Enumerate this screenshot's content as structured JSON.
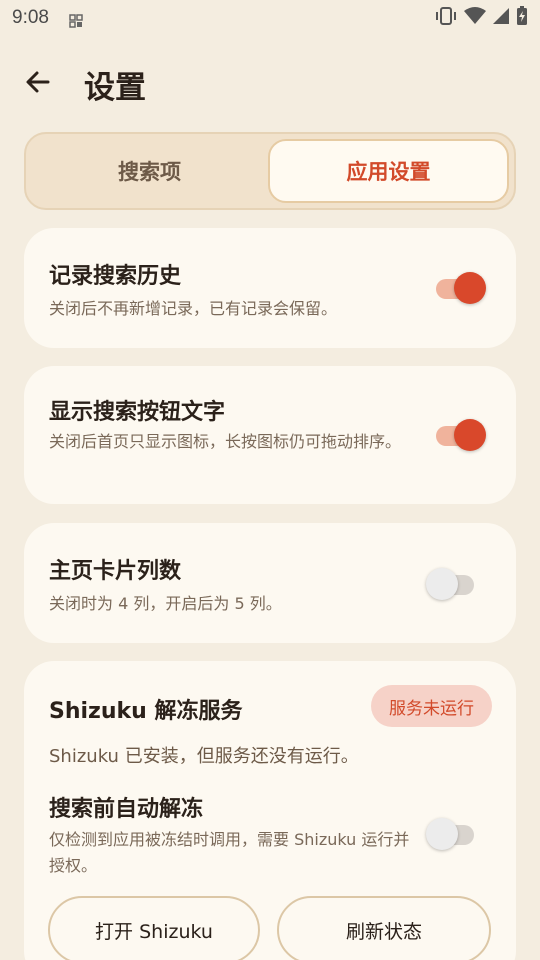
{
  "status_bar": {
    "time": "9:08",
    "icons": [
      "notification-icon",
      "vibrate-icon",
      "wifi-icon",
      "signal-icon",
      "battery-charging-icon"
    ]
  },
  "header": {
    "title": "设置",
    "back_icon": "arrow-left-icon"
  },
  "tabs": [
    {
      "label": "搜索项",
      "active": false
    },
    {
      "label": "应用设置",
      "active": true
    }
  ],
  "settings": [
    {
      "title": "记录搜索历史",
      "desc": "关闭后不再新增记录，已有记录会保留。",
      "enabled": true
    },
    {
      "title": "显示搜索按钮文字",
      "desc": "关闭后首页只显示图标，长按图标仍可拖动排序。",
      "enabled": true
    },
    {
      "title": "主页卡片列数",
      "desc": "关闭时为 4 列，开启后为 5 列。",
      "enabled": false
    }
  ],
  "shizuku": {
    "title": "Shizuku 解冻服务",
    "status_badge": "服务未运行",
    "status_text": "Shizuku 已安装，但服务还没有运行。",
    "auto_unfreeze_title": "搜索前自动解冻",
    "auto_unfreeze_desc": "仅检测到应用被冻结时调用，需要 Shizuku 运行并授权。",
    "auto_unfreeze_enabled": false,
    "open_button": "打开 Shizuku",
    "refresh_button": "刷新状态"
  },
  "colors": {
    "background": "#f4ede0",
    "card": "#fdf9f1",
    "accent": "#d9482b",
    "accent_track": "#f0b39c",
    "badge_bg": "#f6d2c8"
  }
}
